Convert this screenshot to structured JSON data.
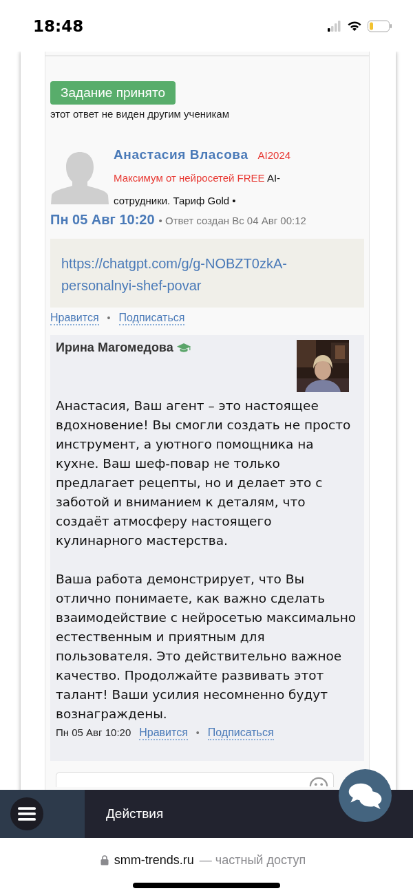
{
  "status_bar": {
    "time": "18:48"
  },
  "answer": {
    "status_button": "Задание принято",
    "visibility_note": "этот ответ не виден другим ученикам",
    "author": {
      "name": "Анастасия Власова",
      "tag": "AI2024",
      "group": "Максимум от нейросетей FREE",
      "plan": "AI-сотрудники. Тариф Gold •"
    },
    "date": "Пн 05 Авг 10:20",
    "created": "• Ответ создан Вс 04 Авг 00:12",
    "link": "https://chatgpt.com/g/g-NOBZT0zkA-personalnyi-shef-povar",
    "actions": [
      "Нравится",
      "Подписаться"
    ],
    "action_separator": "•"
  },
  "comment": {
    "author": "Ирина Магомедова",
    "paragraphs": [
      "Анастасия, Ваш агент – это настоящее вдохновение! Вы смогли создать не просто инструмент, а уютного помощника на кухне. Ваш шеф-повар не только предлагает рецепты, но и делает это с заботой и вниманием к деталям, что создаёт атмосферу настоящего кулинарного мастерства.",
      "Ваша работа демонстрирует, что Вы отлично понимаете, как важно сделать взаимодействие с нейросетью максимально естественным и приятным для пользователя. Это действительно важное качество. Продолжайте развивать этот талант! Ваши усилия несомненно будут вознаграждены."
    ],
    "date": "Пн 05 Авг 10:20",
    "actions": [
      "Нравится",
      "Подписаться"
    ],
    "action_separator": "•"
  },
  "bottom_bar": {
    "label": "Действия"
  },
  "browser": {
    "domain": "smm-trends.ru",
    "note": "— частный доступ"
  }
}
